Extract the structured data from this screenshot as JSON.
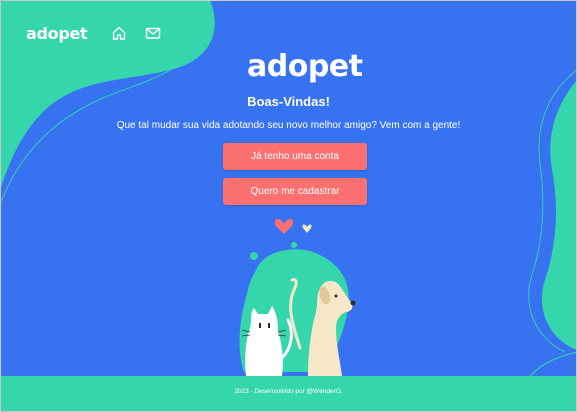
{
  "header": {
    "logo_text": "adopet",
    "nav": [
      {
        "icon": "home-icon"
      },
      {
        "icon": "mail-icon"
      }
    ]
  },
  "main": {
    "logo_text": "adopet",
    "title": "Boas-Vindas!",
    "subtitle": "Que tal mudar sua vida adotando seu novo melhor amigo? Vem com a gente!",
    "login_label": "Já tenho uma conta",
    "register_label": "Quero me cadastrar"
  },
  "footer": {
    "text": "2023 - Desenvolvido por @WenderG."
  },
  "colors": {
    "background": "#3772f0",
    "accent_green": "#36d6ad",
    "button": "#fc7071",
    "text": "#ffffff",
    "cream": "#f6e7c8"
  }
}
